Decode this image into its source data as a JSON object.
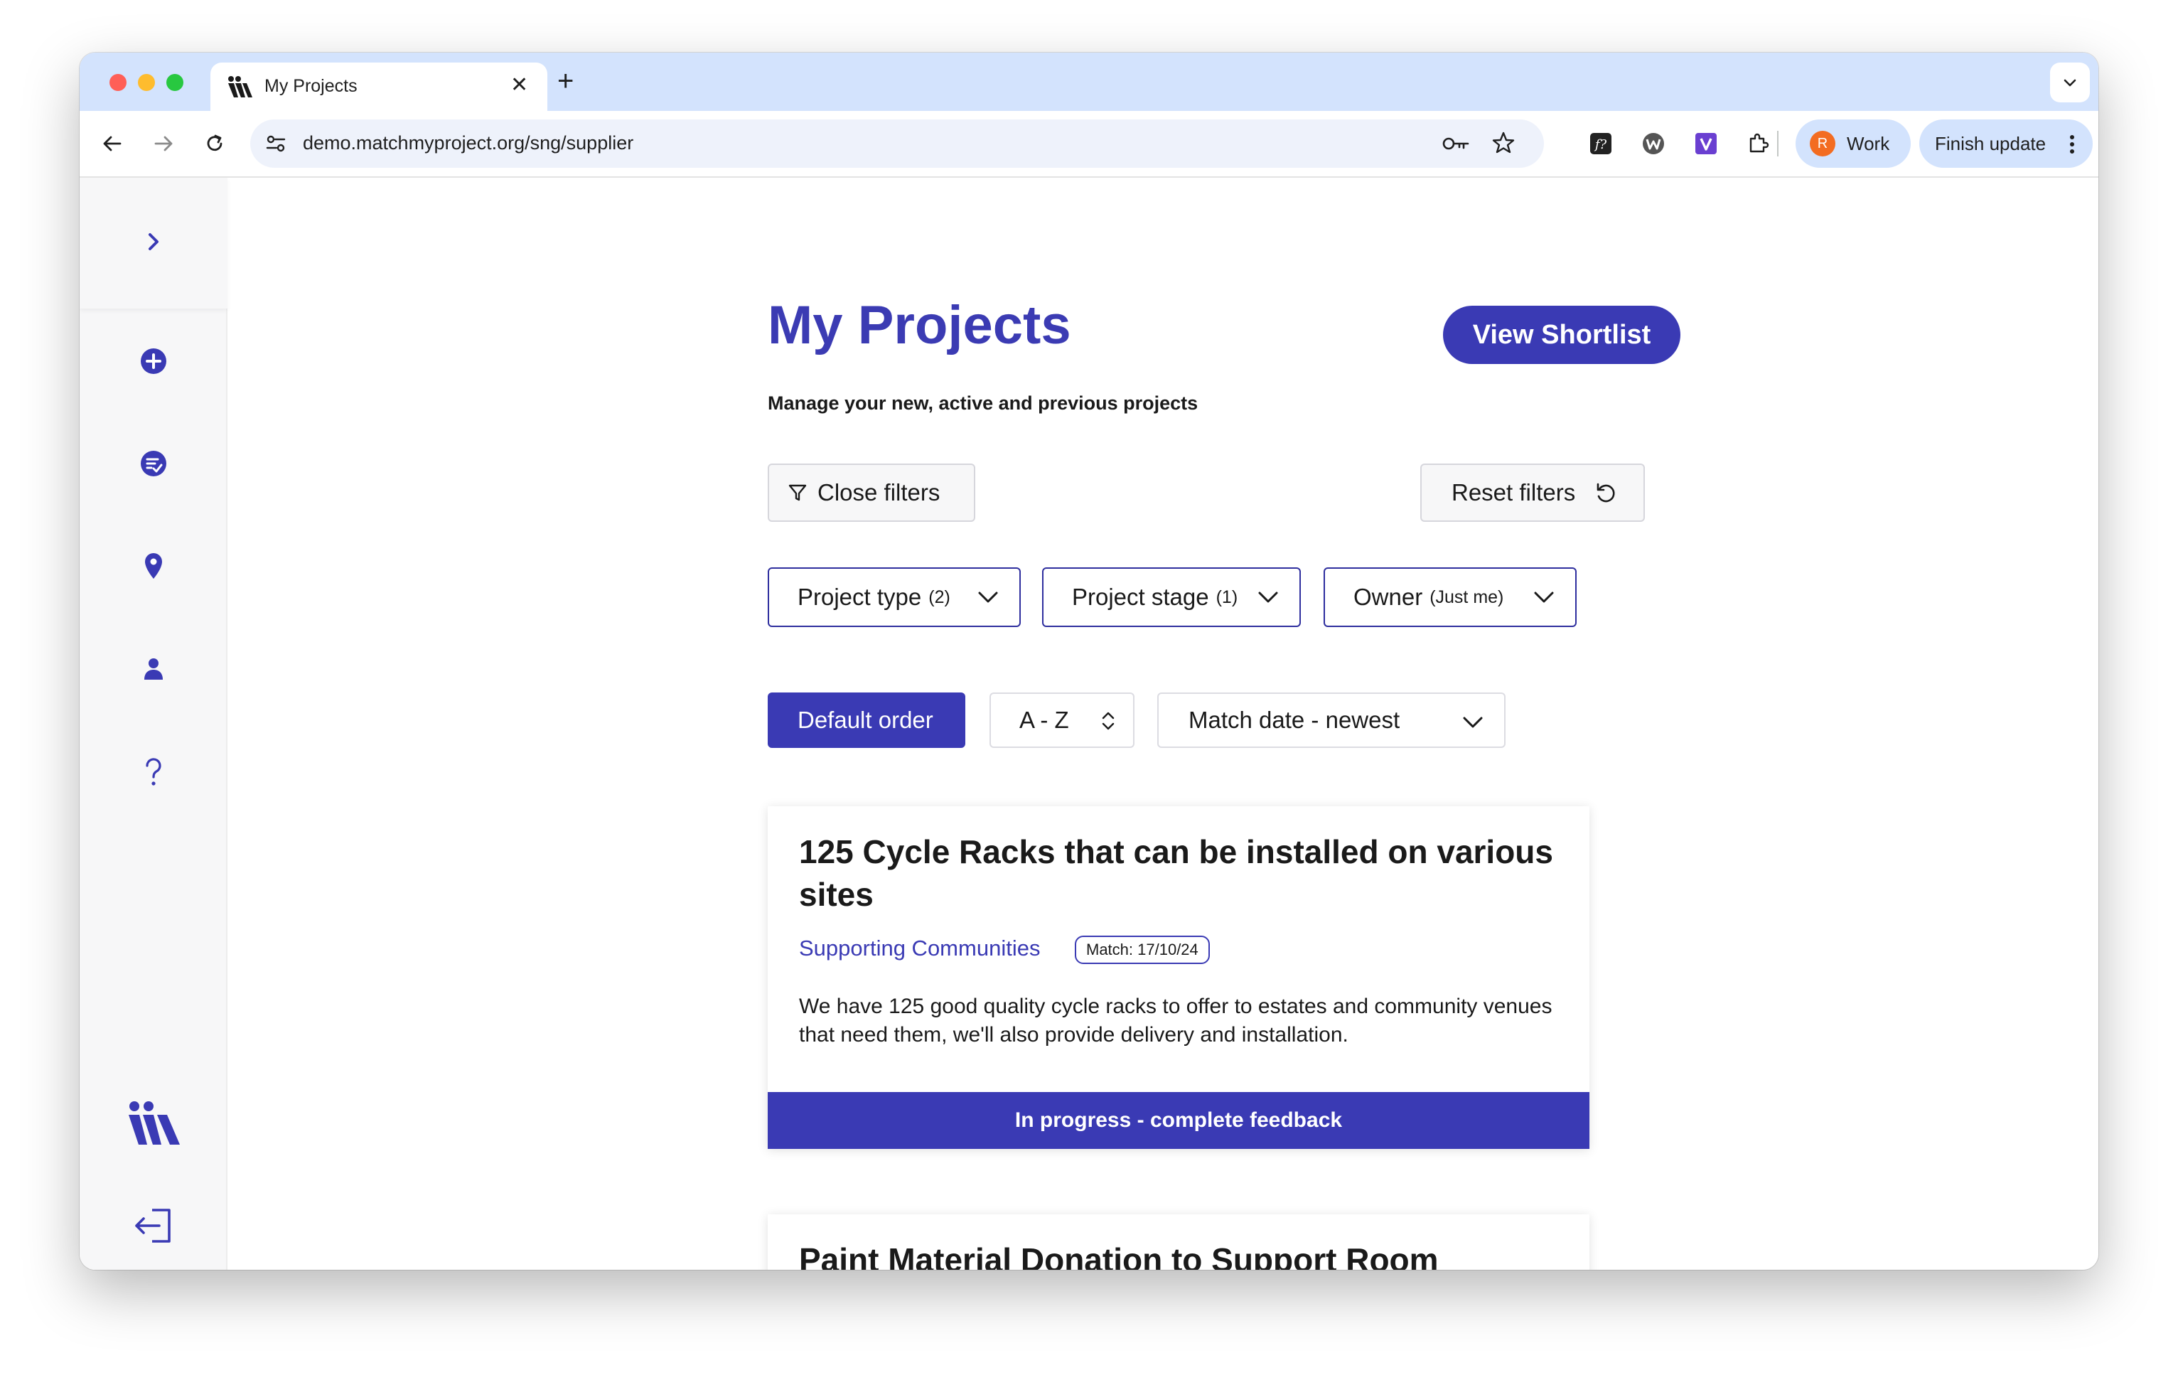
{
  "browser": {
    "tab_title": "My Projects",
    "url": "demo.matchmyproject.org/sng/supplier",
    "profile_initial": "R",
    "profile_label": "Work",
    "update_label": "Finish update"
  },
  "page": {
    "title": "My Projects",
    "subtitle": "Manage your new, active and previous projects",
    "shortlist_button": "View Shortlist",
    "close_filters": "Close filters",
    "reset_filters": "Reset filters",
    "filters": [
      {
        "label": "Project type",
        "count": "(2)"
      },
      {
        "label": "Project stage",
        "count": "(1)"
      },
      {
        "label": "Owner",
        "count": "(Just me)"
      }
    ],
    "sort": {
      "default_order": "Default order",
      "alpha": "A - Z",
      "date": "Match date - newest"
    }
  },
  "projects": [
    {
      "title": "125 Cycle Racks that can be installed on various sites",
      "category": "Supporting Communities",
      "match": "Match: 17/10/24",
      "description": "We have 125 good quality cycle racks to offer to estates and community venues that need them, we'll also provide delivery and installation.",
      "status": "In progress - complete feedback"
    },
    {
      "title": "Paint Material Donation to Support Room Decorations"
    }
  ],
  "colors": {
    "brand": "#3a3ab4",
    "tabstrip": "#d3e3fd"
  }
}
